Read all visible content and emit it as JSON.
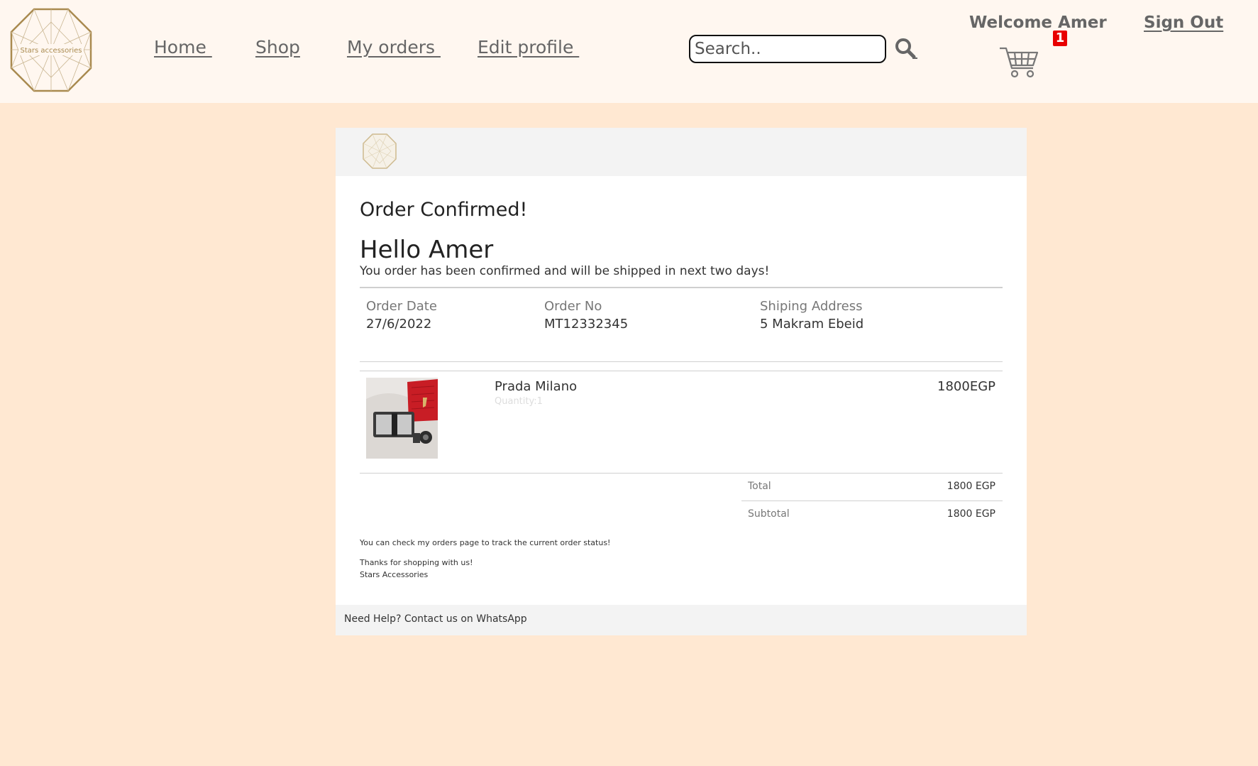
{
  "header": {
    "logo": {
      "brand_text": "Stars accessories",
      "icon": "stars-accessories-logo"
    },
    "nav": [
      {
        "label": "Home "
      },
      {
        "label": "Shop"
      },
      {
        "label": "My orders "
      },
      {
        "label": "Edit profile "
      }
    ],
    "search": {
      "placeholder": "Search..",
      "value": "",
      "icon": "search-icon"
    },
    "welcome": "Welcome Amer",
    "sign_out": "Sign Out",
    "cart": {
      "icon": "cart-icon",
      "count": "1"
    }
  },
  "order": {
    "title": "Order Confirmed!",
    "greeting": "Hello Amer",
    "message": "You order has been confirmed and will be shipped in next two days!",
    "info": {
      "date_label": "Order Date",
      "date_value": "27/6/2022",
      "number_label": "Order No",
      "number_value": "MT12332345",
      "address_label": "Shiping Address",
      "address_value": "5 Makram Ebeid"
    },
    "items": [
      {
        "name": "Prada Milano",
        "quantity": "Quantity:1",
        "price": "1800EGP",
        "image": "product-photo"
      }
    ],
    "summary": {
      "total_label": "Total",
      "total_value": "1800 EGP",
      "subtotal_label": "Subtotal",
      "subtotal_value": "1800 EGP"
    },
    "track_note": "You can check my orders page to track the current order status!",
    "thanks": "Thanks for shopping with us!",
    "signature": "Stars Accessories",
    "help": "Need Help? Contact us on WhatsApp"
  },
  "colors": {
    "page_bg": "#ffe8d2",
    "header_bg": "#fff7f0",
    "logo_gold": "#a98a4f",
    "badge_red": "#e80000"
  }
}
